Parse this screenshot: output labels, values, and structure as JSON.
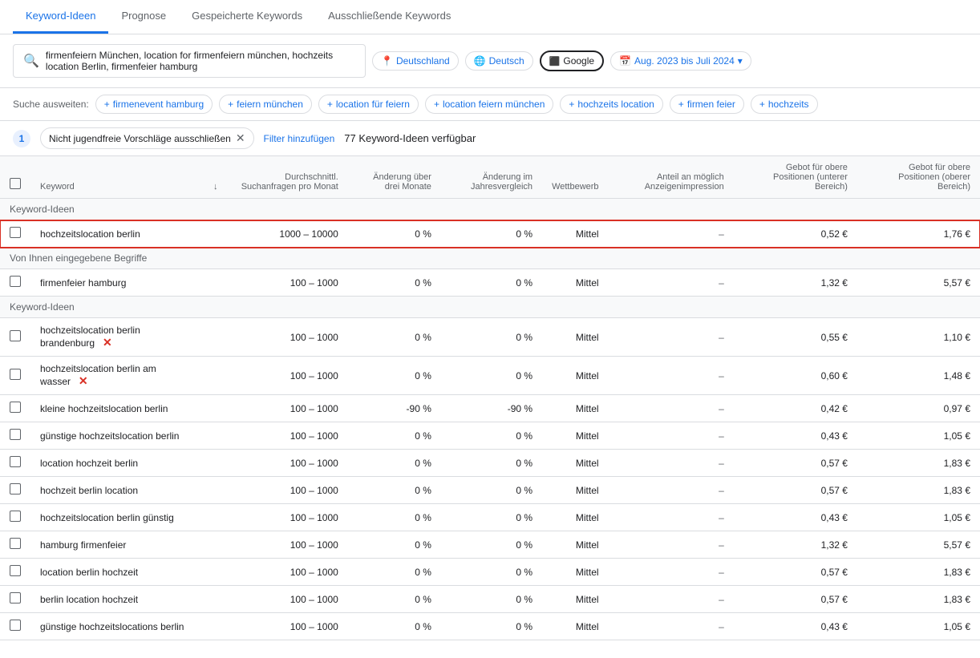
{
  "tabs": [
    {
      "id": "keyword-ideen",
      "label": "Keyword-Ideen",
      "active": true
    },
    {
      "id": "prognose",
      "label": "Prognose",
      "active": false
    },
    {
      "id": "gespeicherte-keywords",
      "label": "Gespeicherte Keywords",
      "active": false
    },
    {
      "id": "ausschliessende-keywords",
      "label": "Ausschließende Keywords",
      "active": false
    }
  ],
  "search": {
    "value": "firmenfeiern München, location for firmenfeiern münchen, hochzeits location Berlin, firmenfeier hamburg"
  },
  "filter_pills": [
    {
      "label": "Deutschland",
      "icon": "📍"
    },
    {
      "label": "Deutsch",
      "icon": "🌐"
    },
    {
      "label": "Google",
      "icon": "🔍"
    },
    {
      "label": "Aug. 2023 bis Juli 2024",
      "icon": "📅",
      "has_dropdown": true
    }
  ],
  "suggestions": {
    "label": "Suche ausweiten:",
    "items": [
      "firmenevent hamburg",
      "feiern münchen",
      "location für feiern",
      "location feiern münchen",
      "hochzeits location",
      "firmen feier",
      "hochzeits"
    ]
  },
  "filter_row": {
    "badge": "1",
    "chip_label": "Nicht jugendfreie Vorschläge ausschließen",
    "add_filter_label": "Filter hinzufügen",
    "count_label": "77 Keyword-Ideen verfügbar"
  },
  "table": {
    "columns": [
      {
        "id": "check",
        "label": ""
      },
      {
        "id": "keyword",
        "label": "Keyword"
      },
      {
        "id": "sort",
        "label": "↓"
      },
      {
        "id": "avg_search",
        "label": "Durchschnittl. Suchanfragen pro Monat"
      },
      {
        "id": "change_3m",
        "label": "Änderung über drei Monate"
      },
      {
        "id": "change_yoy",
        "label": "Änderung im Jahresvergleich"
      },
      {
        "id": "competition",
        "label": "Wettbewerb"
      },
      {
        "id": "impression_share",
        "label": "Anteil an möglich Anzeigenimpression"
      },
      {
        "id": "bid_low",
        "label": "Gebot für obere Positionen (unterer Bereich)"
      },
      {
        "id": "bid_high",
        "label": "Gebot für obere Positionen (oberer Bereich)"
      }
    ],
    "sections": [
      {
        "type": "section-header",
        "label": "Keyword-Ideen"
      },
      {
        "type": "row",
        "highlighted": true,
        "keyword": "hochzeitslocation berlin",
        "has_x": false,
        "avg_search": "1000 – 10000",
        "change_3m": "0 %",
        "change_yoy": "0 %",
        "competition": "Mittel",
        "impression_share": "–",
        "bid_low": "0,52 €",
        "bid_high": "1,76 €"
      },
      {
        "type": "section-header",
        "label": "Von Ihnen eingegebene Begriffe"
      },
      {
        "type": "row",
        "highlighted": false,
        "keyword": "firmenfeier hamburg",
        "has_x": false,
        "avg_search": "100 – 1000",
        "change_3m": "0 %",
        "change_yoy": "0 %",
        "competition": "Mittel",
        "impression_share": "–",
        "bid_low": "1,32 €",
        "bid_high": "5,57 €"
      },
      {
        "type": "section-header",
        "label": "Keyword-Ideen"
      },
      {
        "type": "row",
        "highlighted": false,
        "keyword": "hochzeitslocation berlin brandenburg",
        "has_x": true,
        "avg_search": "100 – 1000",
        "change_3m": "0 %",
        "change_yoy": "0 %",
        "competition": "Mittel",
        "impression_share": "–",
        "bid_low": "0,55 €",
        "bid_high": "1,10 €"
      },
      {
        "type": "row",
        "highlighted": false,
        "keyword": "hochzeitslocation berlin am wasser",
        "has_x": true,
        "avg_search": "100 – 1000",
        "change_3m": "0 %",
        "change_yoy": "0 %",
        "competition": "Mittel",
        "impression_share": "–",
        "bid_low": "0,60 €",
        "bid_high": "1,48 €"
      },
      {
        "type": "row",
        "highlighted": false,
        "keyword": "kleine hochzeitslocation berlin",
        "has_x": false,
        "avg_search": "100 – 1000",
        "change_3m": "-90 %",
        "change_yoy": "-90 %",
        "competition": "Mittel",
        "impression_share": "–",
        "bid_low": "0,42 €",
        "bid_high": "0,97 €"
      },
      {
        "type": "row",
        "highlighted": false,
        "keyword": "günstige hochzeitslocation berlin",
        "has_x": false,
        "avg_search": "100 – 1000",
        "change_3m": "0 %",
        "change_yoy": "0 %",
        "competition": "Mittel",
        "impression_share": "–",
        "bid_low": "0,43 €",
        "bid_high": "1,05 €"
      },
      {
        "type": "row",
        "highlighted": false,
        "keyword": "location hochzeit berlin",
        "has_x": false,
        "avg_search": "100 – 1000",
        "change_3m": "0 %",
        "change_yoy": "0 %",
        "competition": "Mittel",
        "impression_share": "–",
        "bid_low": "0,57 €",
        "bid_high": "1,83 €"
      },
      {
        "type": "row",
        "highlighted": false,
        "keyword": "hochzeit berlin location",
        "has_x": false,
        "avg_search": "100 – 1000",
        "change_3m": "0 %",
        "change_yoy": "0 %",
        "competition": "Mittel",
        "impression_share": "–",
        "bid_low": "0,57 €",
        "bid_high": "1,83 €"
      },
      {
        "type": "row",
        "highlighted": false,
        "keyword": "hochzeitslocation berlin günstig",
        "has_x": false,
        "avg_search": "100 – 1000",
        "change_3m": "0 %",
        "change_yoy": "0 %",
        "competition": "Mittel",
        "impression_share": "–",
        "bid_low": "0,43 €",
        "bid_high": "1,05 €"
      },
      {
        "type": "row",
        "highlighted": false,
        "keyword": "hamburg firmenfeier",
        "has_x": false,
        "avg_search": "100 – 1000",
        "change_3m": "0 %",
        "change_yoy": "0 %",
        "competition": "Mittel",
        "impression_share": "–",
        "bid_low": "1,32 €",
        "bid_high": "5,57 €"
      },
      {
        "type": "row",
        "highlighted": false,
        "keyword": "location berlin hochzeit",
        "has_x": false,
        "avg_search": "100 – 1000",
        "change_3m": "0 %",
        "change_yoy": "0 %",
        "competition": "Mittel",
        "impression_share": "–",
        "bid_low": "0,57 €",
        "bid_high": "1,83 €"
      },
      {
        "type": "row",
        "highlighted": false,
        "keyword": "berlin location hochzeit",
        "has_x": false,
        "avg_search": "100 – 1000",
        "change_3m": "0 %",
        "change_yoy": "0 %",
        "competition": "Mittel",
        "impression_share": "–",
        "bid_low": "0,57 €",
        "bid_high": "1,83 €"
      },
      {
        "type": "row",
        "highlighted": false,
        "keyword": "günstige hochzeitslocations berlin",
        "has_x": false,
        "avg_search": "100 – 1000",
        "change_3m": "0 %",
        "change_yoy": "0 %",
        "competition": "Mittel",
        "impression_share": "–",
        "bid_low": "0,43 €",
        "bid_high": "1,05 €"
      }
    ]
  }
}
